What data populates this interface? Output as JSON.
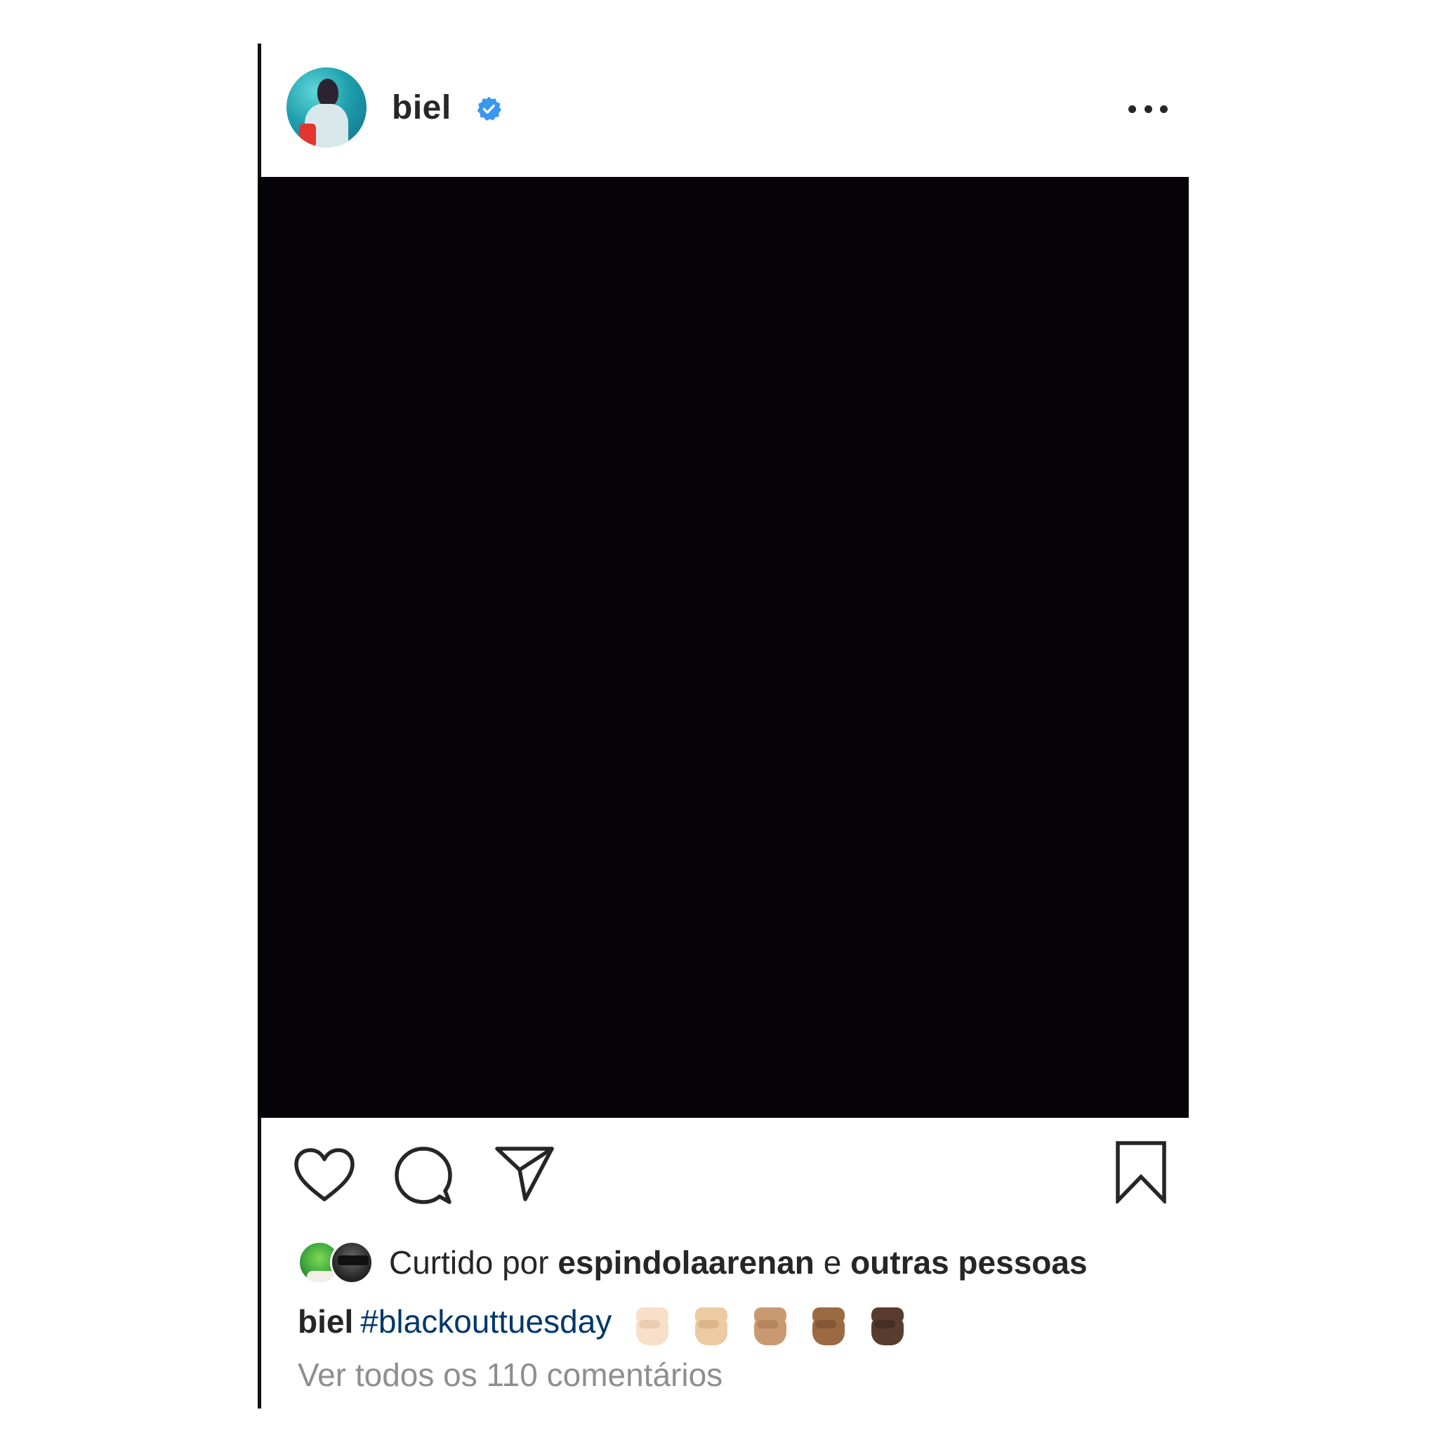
{
  "post": {
    "username": "biel",
    "verified": true,
    "media_color": "#050308",
    "likes": {
      "prefix": "Curtido por",
      "liker": "espindolaarenan",
      "connector": "e",
      "others": "outras pessoas"
    },
    "caption": {
      "username": "biel",
      "hashtag": "#blackouttuesday",
      "emojis": [
        "raised-fist-light",
        "raised-fist-medium-light",
        "raised-fist-medium",
        "raised-fist-medium-dark",
        "raised-fist-dark"
      ]
    },
    "view_comments": "Ver todos os 110 comentários"
  },
  "icons": {
    "more": "more-options-icon",
    "like": "heart-icon",
    "comment": "comment-icon",
    "share": "paper-plane-icon",
    "save": "bookmark-icon",
    "verified": "verified-badge-icon"
  },
  "colors": {
    "text": "#262626",
    "hashtag": "#00376b",
    "muted": "#8e8e8e",
    "verified": "#3897f0",
    "skin_tones": [
      "#f7dfc9",
      "#eccaa2",
      "#c99a72",
      "#9b6a43",
      "#5a3c2e"
    ]
  }
}
